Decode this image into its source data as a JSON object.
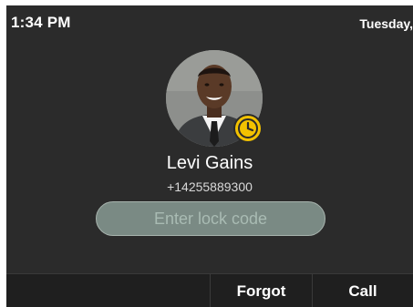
{
  "status_bar": {
    "time": "1:34 PM",
    "date": "Tuesday,"
  },
  "contact": {
    "name": "Levi Gains",
    "number": "+14255889300",
    "avatar_icon": "contact-photo",
    "badge_icon": "clock-icon",
    "badge_color": "#f2c200"
  },
  "lock_code": {
    "placeholder": "Enter lock code",
    "value": ""
  },
  "softkeys": {
    "forgot": "Forgot",
    "call": "Call"
  }
}
